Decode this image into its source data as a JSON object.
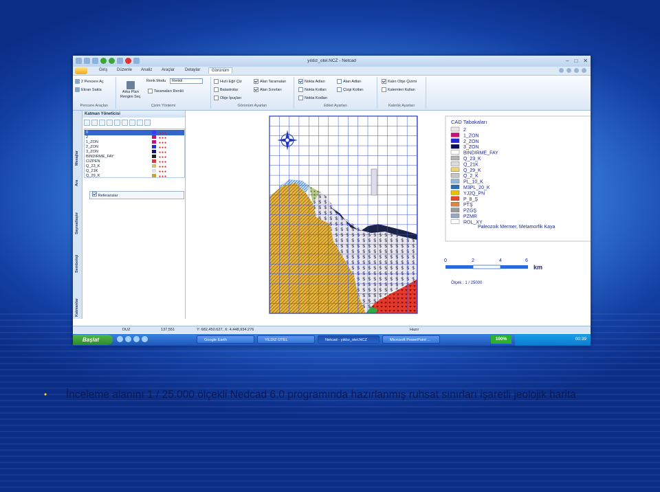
{
  "window": {
    "title": "yıldız_otel.NCZ - Netcad",
    "menu_tabs": [
      "Giriş",
      "Düzenle",
      "Analiz",
      "Araçlar",
      "Detaylar",
      "Görünüm"
    ],
    "active_tab": "Görünüm"
  },
  "ribbon": {
    "pencere": {
      "item1": "2 Pencere Aç",
      "item2": "Ekran Sakla",
      "group": "Pencere Araçları"
    },
    "cizim": {
      "renk_modu": "Renk Modu",
      "renk_modu_value": "Renkli",
      "arka_plan": "Arka Plan",
      "rengini_sec": "Rengini Seç",
      "taramalar": "Taramaları Renkli",
      "group": "Çizim Yöntemi"
    },
    "gorunum": {
      "hizli": "Hızlı Eğri Çiz",
      "alan_taramalari": "Alan Taramaları",
      "balastrolar": "Balastrolar",
      "alan_sinirlari": "Alan Sınırları",
      "obje_ipuclari": "Obje İpuçları",
      "group": "Görünüm Ayarları"
    },
    "etiket": {
      "nokta_adlari": "Nokta Adları",
      "alan_adlari": "Alan Adları",
      "nokta_kotlari": "Nokta Kotları",
      "cizgi_kotlari": "Çizgi Kotları",
      "nokta_kodlari": "Nokta Kodları",
      "group": "Etiket Ayarları"
    },
    "kalinlik": {
      "kalin": "Kalın Obje Çizimi",
      "kalemleri": "Kalemleri Kullan",
      "group": "Kalınlık Ayarları"
    }
  },
  "side_tabs": [
    "Katmanlar",
    "Semboloji",
    "Sayısallaştır",
    "Ara",
    "Mesajlar"
  ],
  "layer_panel": {
    "title": "Katman Yöneticisi",
    "layers": [
      {
        "name": "0",
        "color": "#3a3aff"
      },
      {
        "name": "2",
        "color": "#c0127a"
      },
      {
        "name": "1_ZON",
        "color": "#c0127a"
      },
      {
        "name": "2_ZON",
        "color": "#2a2ad8"
      },
      {
        "name": "3_ZON",
        "color": "#101070"
      },
      {
        "name": "BINDIRME_FAY",
        "color": "#202020"
      },
      {
        "name": "CIZPEN",
        "color": "#d43b3b"
      },
      {
        "name": "Q_23_K",
        "color": "#d4c070"
      },
      {
        "name": "Q_21K",
        "color": "#e0e0e0"
      },
      {
        "name": "Q_29_K",
        "color": "#c9a227"
      }
    ],
    "reference": "Referanslar"
  },
  "map": {
    "legend_title": "CAD Tabakaları",
    "legend": [
      {
        "label": "2",
        "color": "#e8e8e8"
      },
      {
        "label": "1_ZON",
        "color": "#c8106e"
      },
      {
        "label": "2_ZON",
        "color": "#2828d0"
      },
      {
        "label": "3_ZON",
        "color": "#0c0c60"
      },
      {
        "label": "BINDIRME_FAY",
        "color": "#ffffff"
      },
      {
        "label": "Q_23_K",
        "color": "#b5b5b5"
      },
      {
        "label": "Q_21K",
        "color": "#dcdcdc"
      },
      {
        "label": "Q_29_K",
        "color": "#e8d27a"
      },
      {
        "label": "Q_2_K",
        "color": "#c6c6c6"
      },
      {
        "label": "PL_10_K",
        "color": "#8fbbe0"
      },
      {
        "label": "M3PL_20_K",
        "color": "#2a6fb0"
      },
      {
        "label": "YJ2Q_PN",
        "color": "#e6c200"
      },
      {
        "label": "P_8_Ş",
        "color": "#e24a2a"
      },
      {
        "label": "PTŞ",
        "color": "#e0843a"
      },
      {
        "label": "PZGŞ",
        "color": "#9a9a9a"
      },
      {
        "label": "PZMR",
        "color": "#9aa7c4"
      },
      {
        "label": "ROL_XY",
        "color": "#ffffff"
      }
    ],
    "pzmr_note": "Paleozoik Mermer, Metamorfik Kaya",
    "scale_ticks": [
      "0",
      "2",
      "4",
      "6"
    ],
    "scale_unit": "km",
    "scale_text": "Ölçek : 1 / 25000"
  },
  "status": {
    "value": "137,551",
    "mode": "DUZ",
    "coords": "Y: 682,450.627, X: 4,448,934.276",
    "ready": "Hazır"
  },
  "taskbar": {
    "start": "Başlat",
    "tasks": [
      "Google Earth",
      "YILDIZ OTEL",
      "Netcad - yıldız_otel.NCZ",
      "Microsoft PowerPoint ..."
    ],
    "zoom": "100%",
    "clock": "00:39"
  },
  "caption": "İnceleme alanını 1 / 25.000 ölçekli Nedcad 6.0 programında hazırlanmış ruhsat sınırları işaretli jeolojik harita"
}
